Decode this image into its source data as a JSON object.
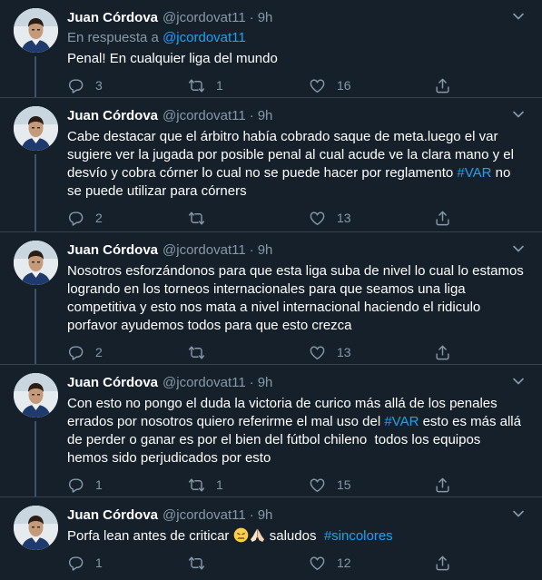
{
  "author": {
    "name": "Juan Córdova",
    "handle": "@jcordovat11",
    "separator": "·"
  },
  "reply_prefix": "En respuesta a",
  "reply_link": "@jcordovat11",
  "tweets": [
    {
      "time": "9h",
      "text": "Penal! En cualquier liga del mundo",
      "replies": "3",
      "retweets": "1",
      "likes": "16"
    },
    {
      "time": "9h",
      "text_before": "Cabe destacar que el árbitro había cobrado saque de meta.luego el var sugiere ver la jugada por posible penal al cual acude ve la clara mano y el desvío y cobra córner lo cual no se puede hacer por reglamento ",
      "hashtag": "#VAR",
      "text_after": " no se puede utilizar para córners",
      "replies": "2",
      "retweets": "",
      "likes": "13"
    },
    {
      "time": "9h",
      "text": "Nosotros esforzándonos para que esta liga suba de nivel lo cual lo estamos logrando en los torneos internacionales para que seamos una liga competitiva y esto nos mata a nivel internacional haciendo el ridiculo porfavor ayudemos todos para que esto crezca",
      "replies": "2",
      "retweets": "",
      "likes": "13"
    },
    {
      "time": "9h",
      "text_before": "Con esto no pongo el duda la victoria de curico más allá de los penales errados por nosotros quiero referirme el mal uso del ",
      "hashtag": "#VAR",
      "text_after": " esto es más allá de perder o ganar es por el bien del fútbol chileno  todos los equipos hemos sido perjudicados por esto",
      "replies": "1",
      "retweets": "1",
      "likes": "15"
    },
    {
      "time": "9h",
      "text_before": "Porfa lean antes de criticar ",
      "text_mid": " saludos  ",
      "hashtag": "#sincolores",
      "replies": "1",
      "retweets": "",
      "likes": "12"
    }
  ],
  "icons": {
    "reply": "reply-bubble-icon",
    "retweet": "retweet-icon",
    "like": "heart-icon",
    "share": "share-icon",
    "more": "chevron-down-icon",
    "emoji": [
      "persevering-face-emoji",
      "folded-hands-emoji"
    ]
  },
  "colors": {
    "background": "#15202b",
    "secondary_text": "#8899a6",
    "link": "#1da1f2",
    "divider": "#38444d"
  }
}
